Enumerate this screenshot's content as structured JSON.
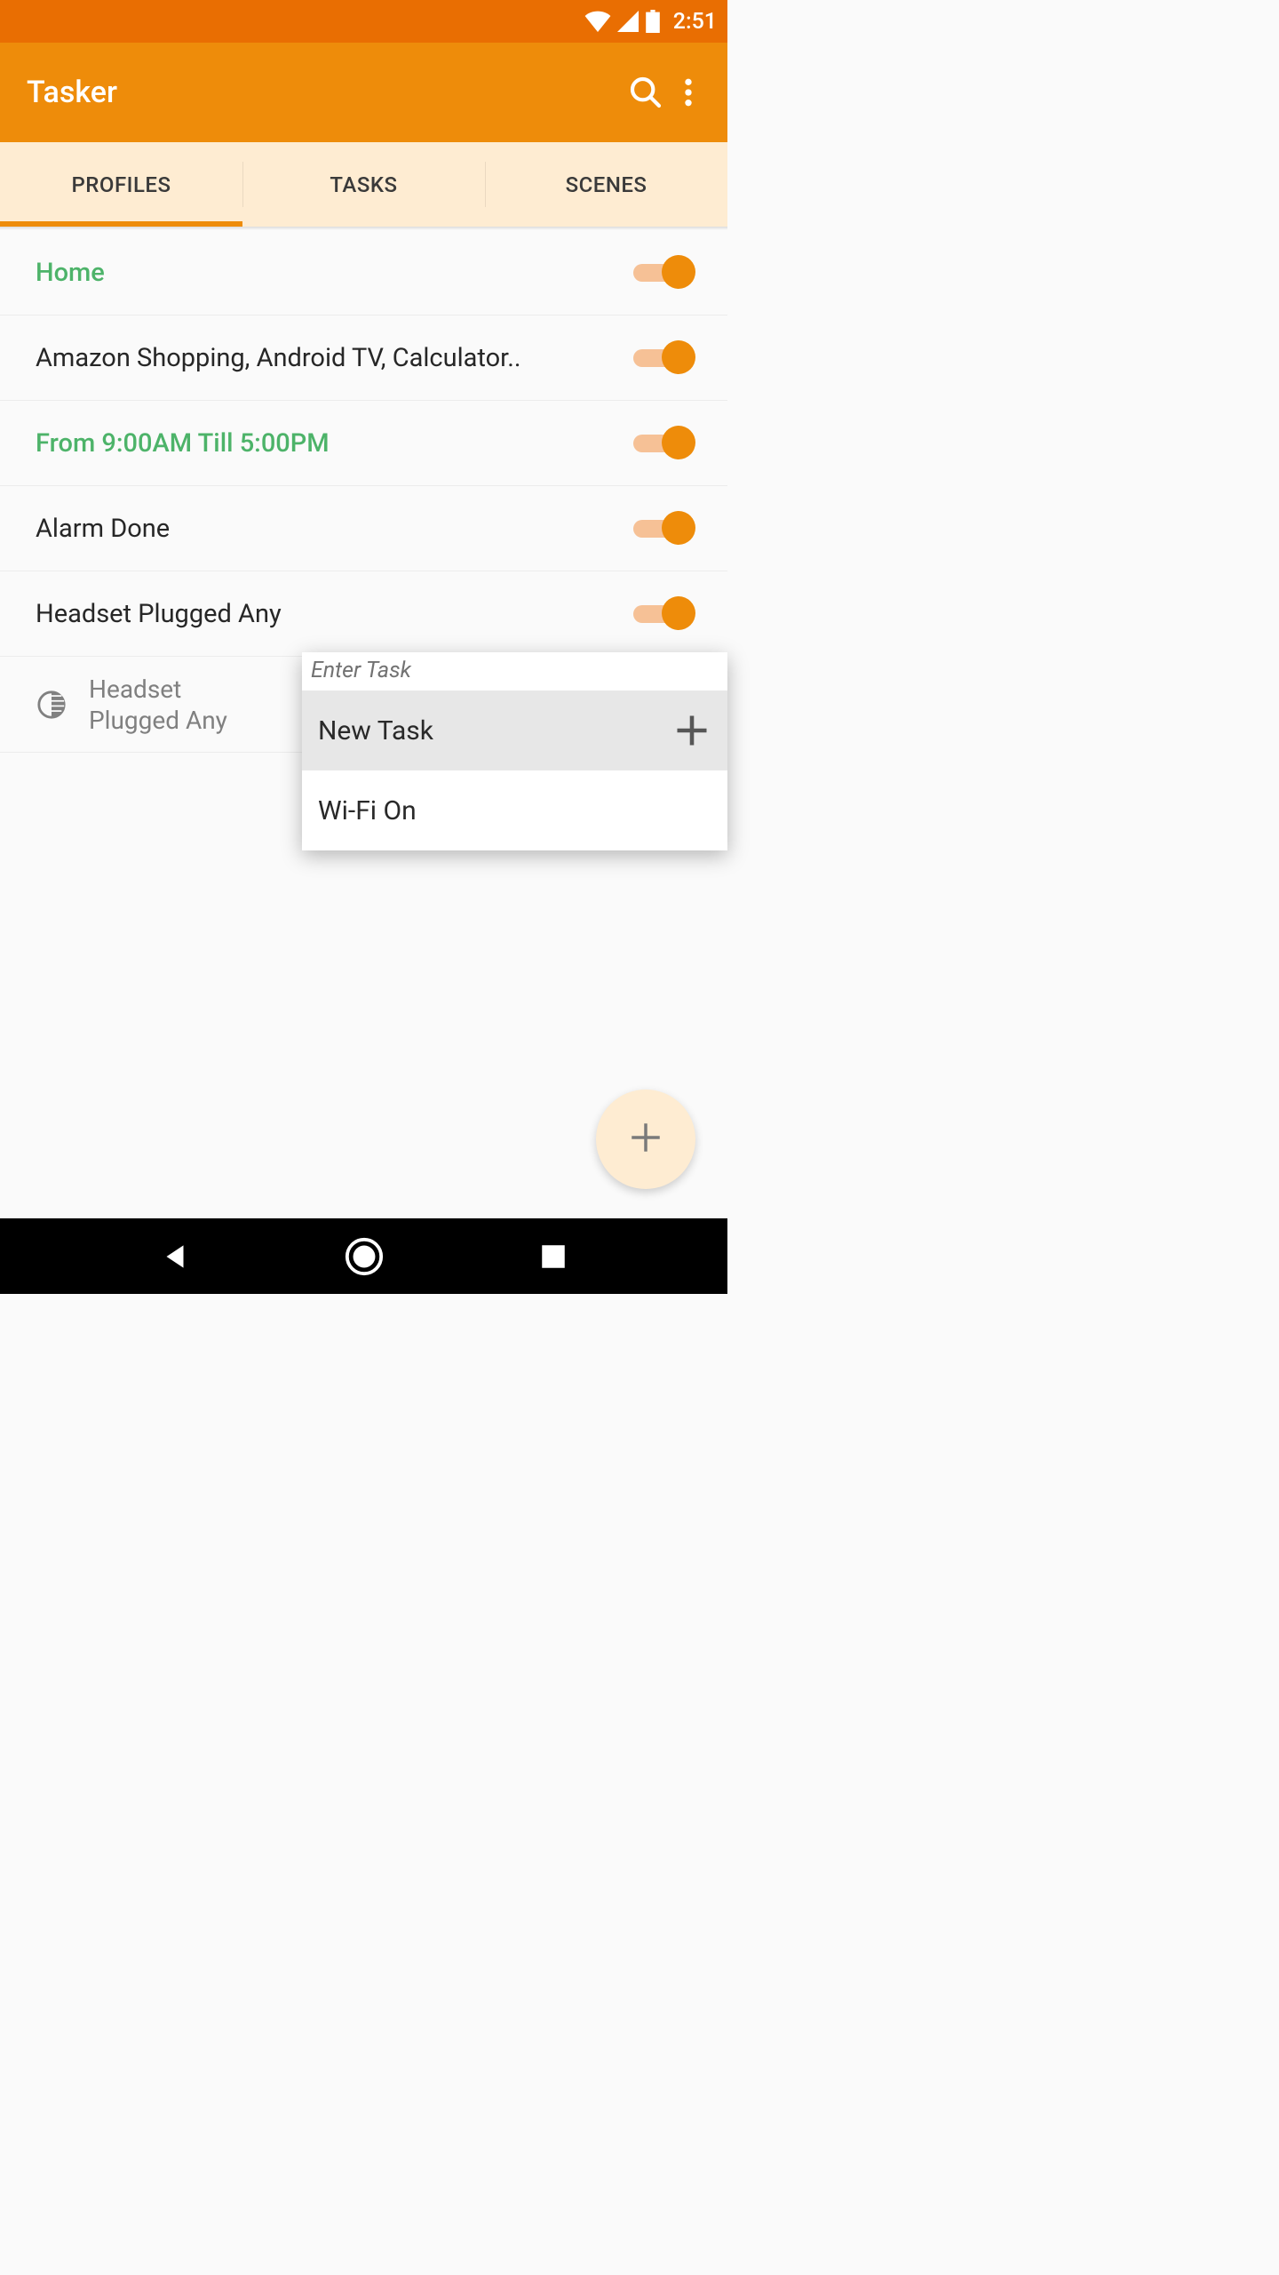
{
  "status": {
    "time": "2:51"
  },
  "appbar": {
    "title": "Tasker"
  },
  "tabs": {
    "items": [
      {
        "label": "PROFILES"
      },
      {
        "label": "TASKS"
      },
      {
        "label": "SCENES"
      }
    ]
  },
  "profiles": [
    {
      "label": "Home",
      "highlight": true,
      "enabled": true
    },
    {
      "label": "Amazon Shopping, Android TV, Calculator..",
      "highlight": false,
      "enabled": true
    },
    {
      "label": "From  9:00AM Till  5:00PM",
      "highlight": true,
      "enabled": true
    },
    {
      "label": "Alarm Done",
      "highlight": false,
      "enabled": true
    },
    {
      "label": "Headset Plugged Any",
      "highlight": false,
      "enabled": true
    }
  ],
  "expanded": {
    "icon": "half-circle-icon",
    "label": "Headset Plugged Any"
  },
  "popup": {
    "header": "Enter Task",
    "items": [
      {
        "label": "New Task",
        "hasPlus": true,
        "selected": true
      },
      {
        "label": "Wi-Fi On",
        "hasPlus": false,
        "selected": false
      }
    ]
  }
}
